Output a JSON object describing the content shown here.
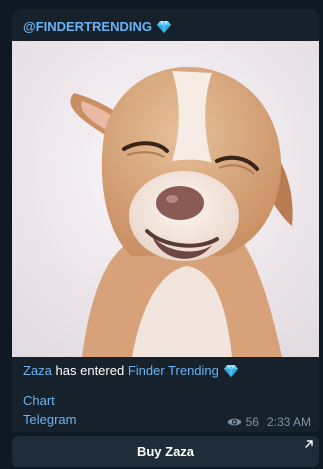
{
  "message": {
    "channel_name": "@FINDERTRENDING",
    "text": {
      "token": "Zaza",
      "middle": "has entered",
      "list_name": "Finder Trending"
    },
    "links": [
      "Chart",
      "Telegram"
    ],
    "views": "56",
    "time": "2:33 AM"
  },
  "button": {
    "label": "Buy Zaza",
    "icon": "external-link-arrow-icon"
  },
  "icons": {
    "gem": "diamond-icon",
    "views": "eye-icon"
  },
  "colors": {
    "background": "#0f1923",
    "bubble": "#17212b",
    "link": "#6ab3f3",
    "meta": "#7f91a4",
    "button": "#1e2c3a"
  }
}
